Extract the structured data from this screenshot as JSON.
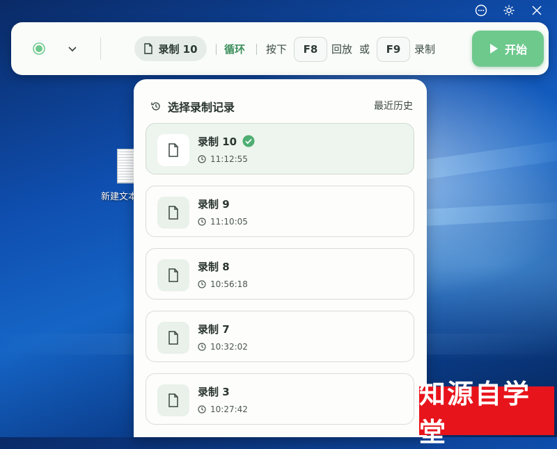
{
  "window_controls": [
    {
      "icon": "chat-icon"
    },
    {
      "icon": "gear-icon"
    },
    {
      "icon": "close-icon"
    }
  ],
  "toolbar": {
    "record_indicator_icon": "record-dot-icon",
    "dropdown_icon": "chevron-down-icon",
    "current_recording": "录制 10",
    "loop_label": "循环",
    "press_label": "按下",
    "playback_key": "F8",
    "playback_label": "回放",
    "or_label": "或",
    "record_key": "F9",
    "record_label": "录制",
    "start_label": "开始"
  },
  "desktop": {
    "file_label": "新建文本文档.txt"
  },
  "panel": {
    "title": "选择录制记录",
    "history_link": "最近历史",
    "items": [
      {
        "name": "录制 10",
        "time": "11:12:55",
        "selected": true
      },
      {
        "name": "录制 9",
        "time": "11:10:05",
        "selected": false
      },
      {
        "name": "录制 8",
        "time": "10:56:18",
        "selected": false
      },
      {
        "name": "录制 7",
        "time": "10:32:02",
        "selected": false
      },
      {
        "name": "录制 3",
        "time": "10:27:42",
        "selected": false
      }
    ]
  },
  "watermark": "知源自学堂",
  "colors": {
    "accent_green": "#6ec98d",
    "dark_green": "#3e8f5c",
    "watermark_red": "#e8141c"
  }
}
